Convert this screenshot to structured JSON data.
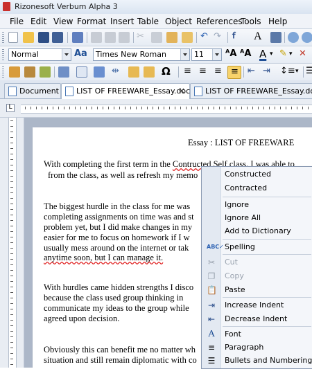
{
  "app": {
    "title": "Rizonesoft Verbum Alpha 3"
  },
  "menu": [
    "File",
    "Edit",
    "View",
    "Format",
    "Insert",
    "Table",
    "Object",
    "References",
    "Tools",
    "Help"
  ],
  "toolbar": {
    "style_value": "Normal",
    "font_value": "Times New Roman",
    "size_value": "11"
  },
  "tabs": [
    {
      "label": "Document 1"
    },
    {
      "label": "LIST OF FREEWARE_Essay.doc",
      "close": "×"
    },
    {
      "label": "LIST OF FREEWARE_Essay.docx"
    }
  ],
  "doc": {
    "heading": "Essay : LIST OF FREEWARE",
    "p1_l1": "With completing the first term in the Contructed Self class, I was able to",
    "p1_l2": "from the class, as well as refresh my memo",
    "p2_l1": "The biggest hurdle in the class for me was",
    "p2_l2": "completing assignments on time was and st",
    "p2_l3": "problem yet, but I did make changes in my",
    "p2_l4": "easier for me to focus on homework if I w",
    "p2_l5": "usually mess around on the internet or tak",
    "p2_l6": "anytime soon, but I can manage it.",
    "p3_l1": "With hurdles came hidden strengths I disco",
    "p3_l2": "because the class used group thinking in",
    "p3_l3": "communicate my ideas to the group while",
    "p3_l4": "agreed upon decision.",
    "p4_l1": "Obviously this can benefit me no matter wh",
    "p4_l2": "situation and still remain diplomatic with co"
  },
  "context_menu": {
    "items": [
      "Constructed",
      "Contracted",
      "Ignore",
      "Ignore All",
      "Add to Dictionary",
      "Spelling",
      "Cut",
      "Copy",
      "Paste",
      "Increase Indent",
      "Decrease Indent",
      "Font",
      "Paragraph",
      "Bullets and Numbering"
    ]
  },
  "colors": {
    "accent": "#3a6fb0",
    "spell_underline": "#e02020",
    "page_bg": "#acb7c8"
  }
}
